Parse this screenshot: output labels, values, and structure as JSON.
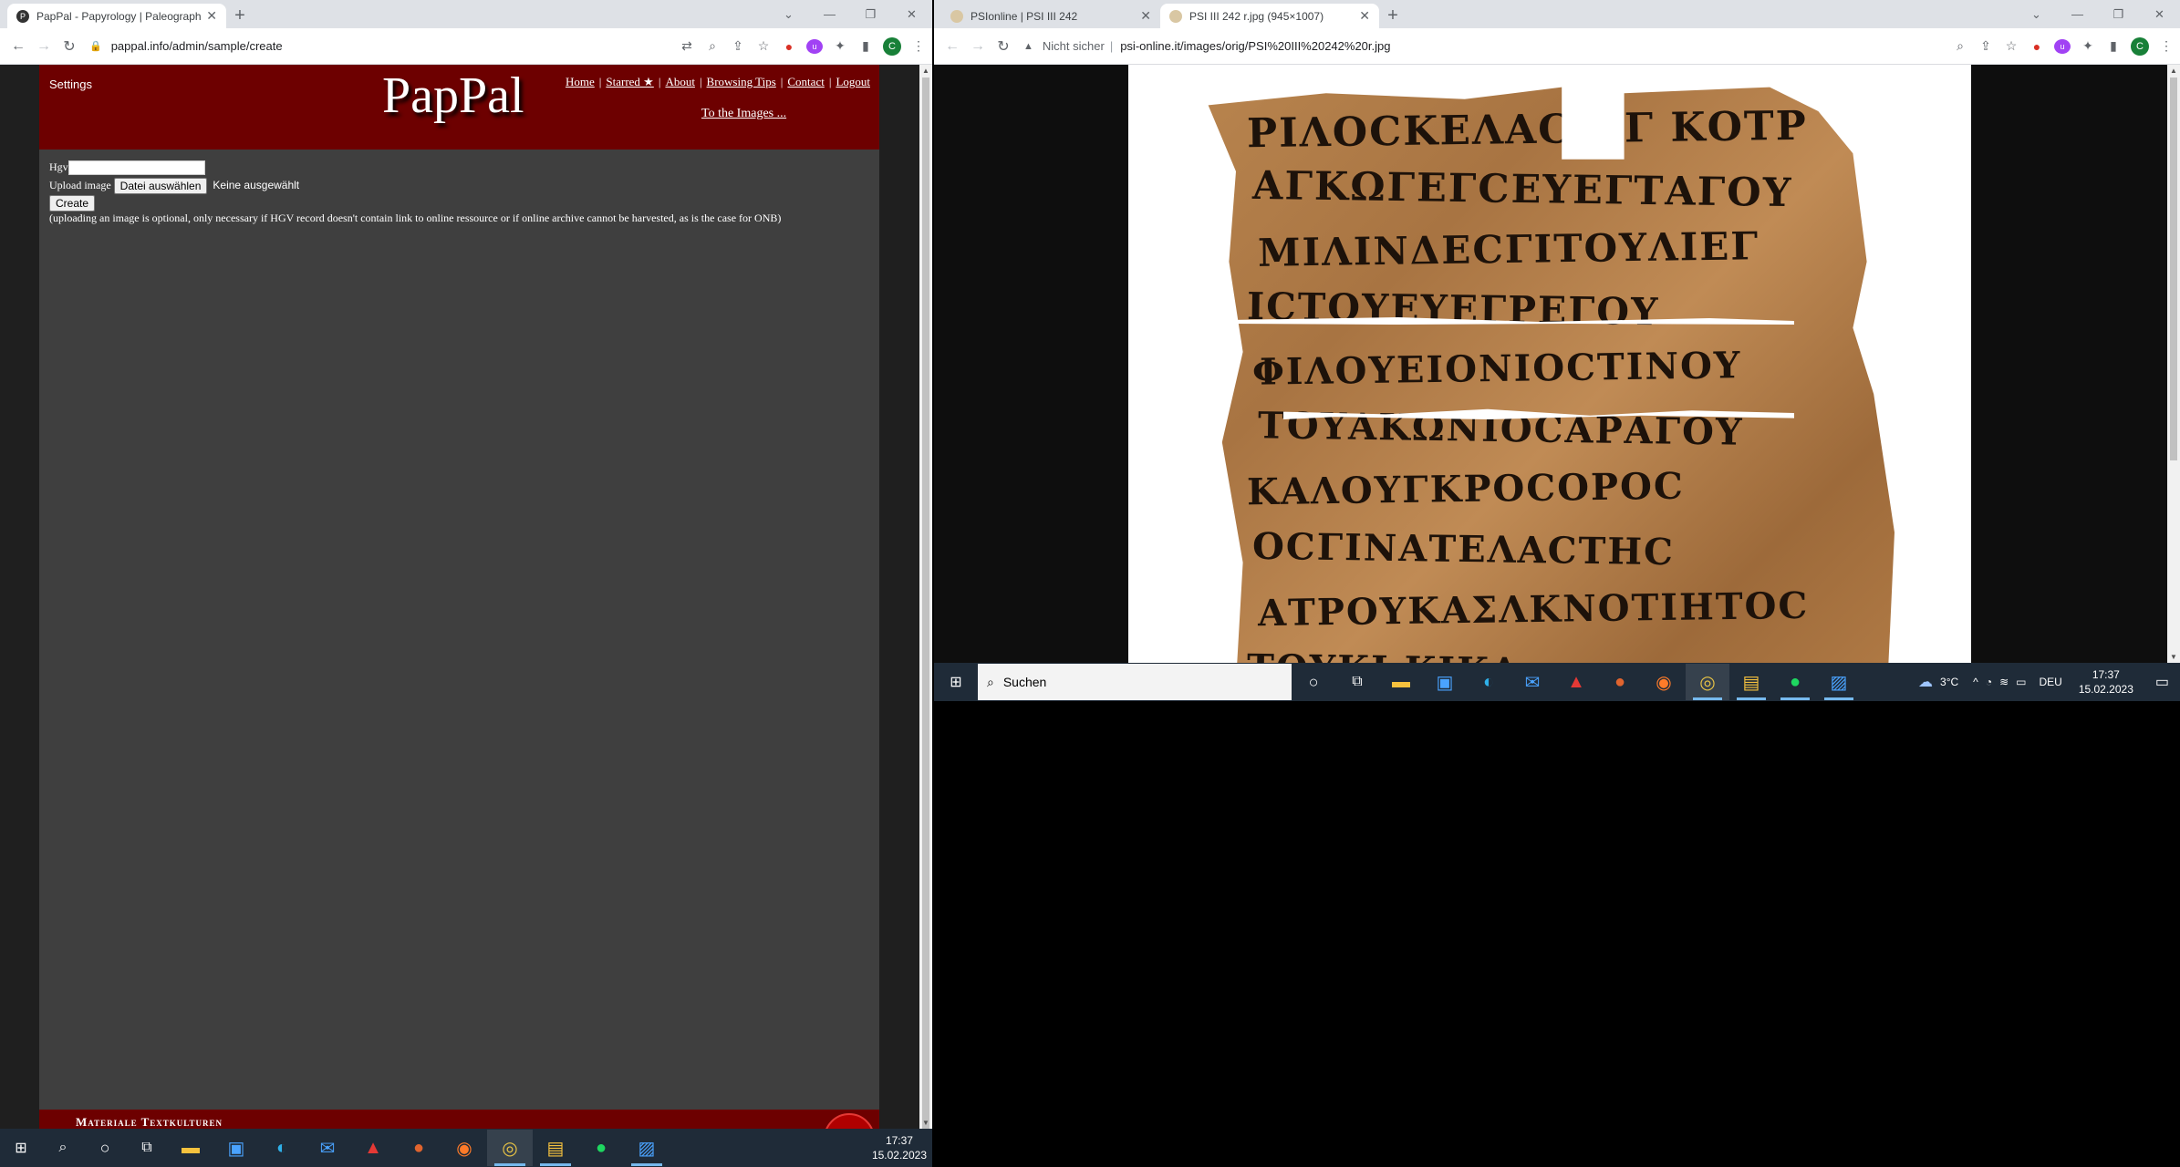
{
  "left_browser": {
    "tab_title": "PapPal - Papyrology | Paleograph",
    "url": "pappal.info/admin/sample/create"
  },
  "pappal": {
    "settings": "Settings",
    "logo": "PapPal",
    "nav": [
      "Home",
      "Starred ★",
      "About",
      "Browsing Tips",
      "Contact",
      "Logout"
    ],
    "images_link": "To the Images ...",
    "hgv_label": "Hgv",
    "upload_label": "Upload image",
    "file_button": "Datei auswählen",
    "file_status": "Keine ausgewählt",
    "create_button": "Create",
    "note": "(uploading an image is optional, only necessary if HGV record doesn't contain link to online ressource or if online archive cannot be harvested, as is the case for ONB)",
    "footer_text": "Materiale Textkulturen"
  },
  "right_browser": {
    "tabs": [
      "PSIonline | PSI III 242",
      "PSI III 242 r.jpg (945×1007)"
    ],
    "insecure_label": "Nicht sicher",
    "url": "psi-online.it/images/orig/PSI%20III%20242%20r.jpg"
  },
  "papyrus_lines": [
    "ΡΙΛΟϹΚΕΛΑϹ ΟΓ ΚΟΤΡ",
    "ΑΓΚΩΓΕΓϹΕΥΕΓΤΑΓΟΥ",
    "ΜΙΛΙΝΔΕϹΓΙΤΟΥΛΙΕΓ",
    "ΙϹΤΟΥΕΥΕΓΡΕΓΟΥ",
    "ΦΙΛΟΥΕΙΟΝΙΟϹΤΙΝΟΥ",
    "ΤΟΥΑΚΩΝΙΟϹΑΡΑΓΟΥ",
    "ΚΑΛΟΥΓΚΡΟϹΟΡΟϹ",
    "ΟϹΓΙΝΑΤΕΛΑϹΤΗϹ",
    "ΑΤΡΟΥΚΑΣΛΚΝΟΤΙΗΤΟϹ",
    "ΤΟΥΚΙ ΚΙΚΑ"
  ],
  "taskbar_left": {
    "time": "17:37",
    "date": "15.02.2023"
  },
  "taskbar_right": {
    "search_placeholder": "Suchen",
    "weather": "3°C",
    "lang": "DEU",
    "time": "17:37",
    "date": "15.02.2023"
  }
}
